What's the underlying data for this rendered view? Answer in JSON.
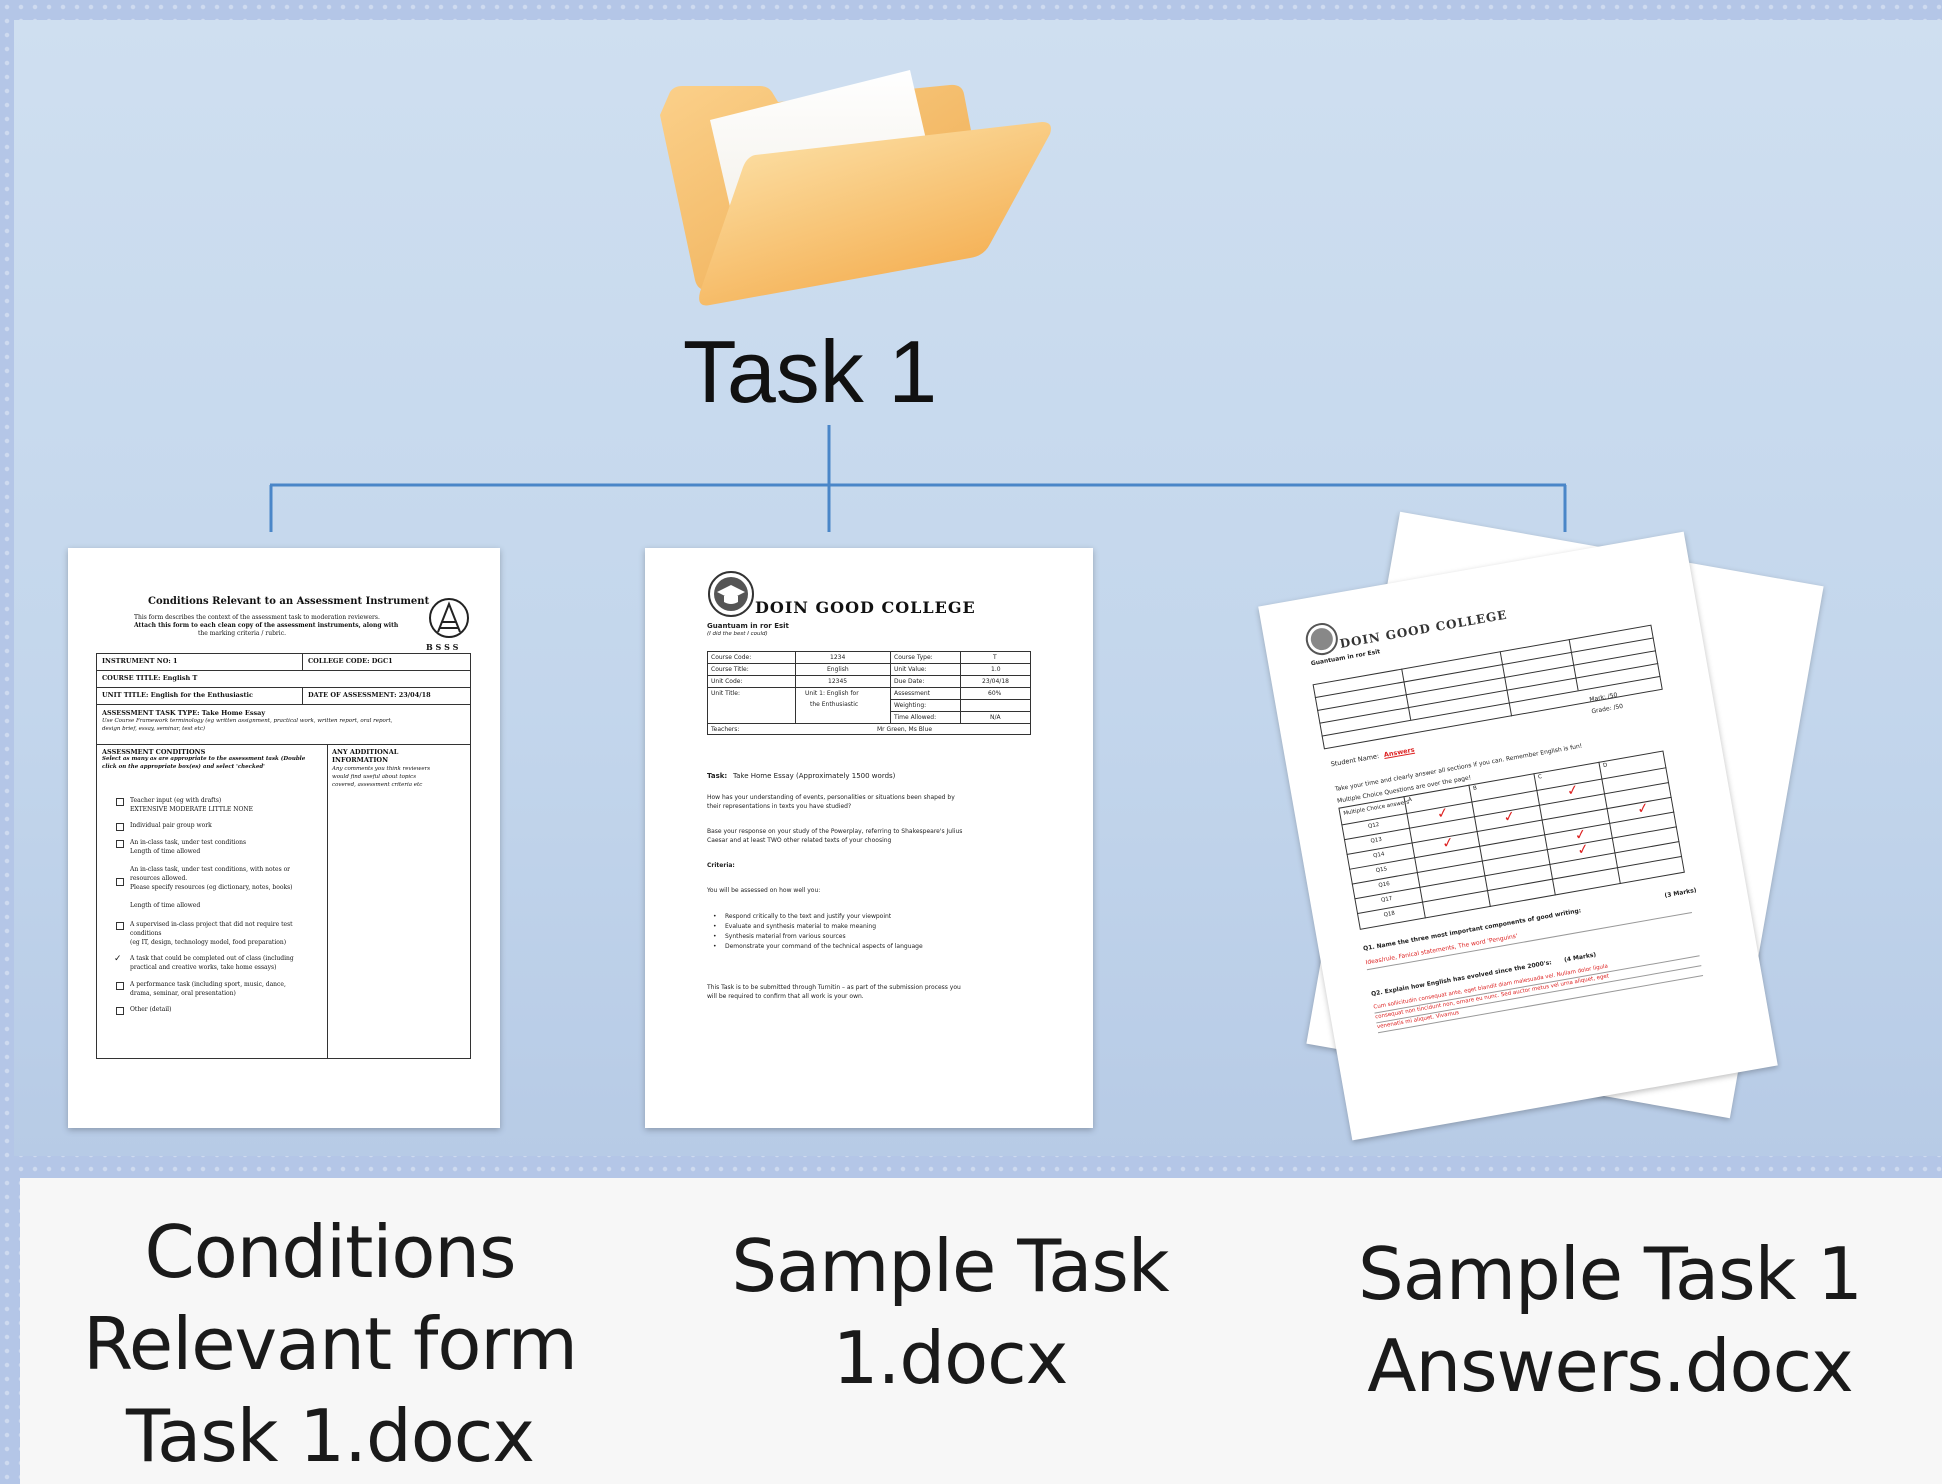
{
  "root": {
    "label": "Task 1"
  },
  "colors": {
    "connector": "#4a86c8",
    "folder_front": "#f6b95a",
    "folder_back": "#f3c06c"
  },
  "icons": {
    "root": "folder-icon"
  },
  "files": [
    {
      "name": "Conditions Relevant form Task 1.docx",
      "name_lines": [
        "Conditions",
        "Relevant form",
        "Task 1.docx"
      ],
      "preview": {
        "title": "Conditions Relevant to an Assessment Instrument",
        "intro": [
          "This form describes the context of the assessment task to moderation reviewers.",
          "Attach this form to each clean copy of the assessment instruments, along with",
          "the marking criteria / rubric."
        ],
        "logo_text": "B S S S",
        "instrument_no": "INSTRUMENT NO: 1",
        "college_code": "COLLEGE CODE: DGC1",
        "course_title": "COURSE TITLE: English T",
        "unit_title": "UNIT TITLE: English for the Enthusiastic",
        "date": "DATE OF ASSESSMENT: 23/04/18",
        "task_type": "ASSESSMENT TASK TYPE: Take Home Essay",
        "task_type_note": [
          "Use Course Framework terminology (eg written assignment, practical work, written report, oral report,",
          "design brief, essay, seminar, test etc)"
        ],
        "conditions_heading": "ASSESSMENT CONDITIONS",
        "conditions_note": [
          "Select as many as are appropriate to the assessment task (Double",
          "click on the appropriate box(es) and select 'checked'"
        ],
        "additional_heading": [
          "ANY ADDITIONAL",
          "INFORMATION"
        ],
        "additional_note": [
          "Any comments you think reviewers",
          "would find useful about topics",
          "covered, assessment criteria etc"
        ],
        "items": [
          "Teacher input (eg with drafts)",
          "EXTENSIVE   MODERATE   LITTLE   NONE",
          "Individual   pair   group work",
          "An in-class task, under test conditions",
          "Length of time allowed",
          "An in-class task, under test conditions, with notes or",
          "resources allowed.",
          "Please specify resources (eg dictionary, notes, books)",
          "Length of time allowed",
          "A supervised in-class project that did not require test",
          "conditions",
          "(eg IT, design, technology model, food preparation)",
          "A task that could be completed out of class (including",
          "practical and creative works, take home essays)",
          "A performance task (including sport, music, dance,",
          "drama, seminar, oral presentation)",
          "Other (detail)"
        ]
      }
    },
    {
      "name": "Sample Task 1.docx",
      "name_lines": [
        "Sample Task",
        "1.docx"
      ],
      "preview": {
        "college": "DOIN GOOD COLLEGE",
        "subtitle": "Guantuam in ror Esit",
        "subtitle2": "(I did the best I could)",
        "table": [
          [
            "Course Code:",
            "1234",
            "Course Type:",
            "T"
          ],
          [
            "Course Title:",
            "English",
            "Unit Value:",
            "1.0"
          ],
          [
            "Unit Code:",
            "12345",
            "Due Date:",
            "23/04/18"
          ],
          [
            "Unit Title:",
            "Unit 1: English for",
            "Assessment",
            "60%"
          ],
          [
            "",
            "the Enthusiastic",
            "Weighting:",
            ""
          ],
          [
            "",
            "",
            "Time Allowed:",
            "N/A"
          ],
          [
            "Teachers:",
            "",
            "Mr Green, Ms Blue",
            ""
          ]
        ],
        "task_label": "Task:",
        "task_text": "Take Home Essay (Approximately 1500 words)",
        "question": [
          "How has your understanding of events, personalities or situations been shaped by",
          "their representations in texts you have studied?"
        ],
        "base": [
          "Base your response on your study of the Powerplay, referring to Shakespeare's Julius",
          "Caesar and at least TWO other related texts of your choosing"
        ],
        "criteria_heading": "Criteria:",
        "criteria_intro": "You will be assessed on how well you:",
        "criteria": [
          "Respond critically to the text and justify your viewpoint",
          "Evaluate and synthesis material to make meaning",
          "Synthesis material from various sources",
          "Demonstrate your command of the technical aspects of language"
        ],
        "submit": [
          "This Task is to be submitted through Turnitin – as part of the submission process you",
          "will be required to confirm that all work is your own."
        ]
      }
    },
    {
      "name": "Sample Task 1 Answers.docx",
      "name_lines": [
        "Sample Task 1",
        "Answers.docx"
      ],
      "preview": {
        "college": "DOIN GOOD COLLEGE",
        "subtitle": "Guantuam in ror Esit",
        "student_name_label": "Student Name:",
        "student_name_value": "Answers",
        "mark": "Mark: /50",
        "grade": "Grade: /50",
        "instructions": "Take your time and clearly answer all sections if you can. Remember English is fun!",
        "mc_heading": "Multiple Choice Questions are over the page!",
        "mc_rows": [
          "Q12",
          "Q13",
          "Q14",
          "Q15",
          "Q16",
          "Q17",
          "Q18"
        ],
        "mc_cols": [
          "Multiple Choice answers",
          "A",
          "B",
          "C",
          "D"
        ],
        "q1": "Q1. Name the three most important components of good writing:",
        "q1_marks": "(3 Marks)",
        "q1_answer": "Ideas/rule, Fanical statements, The word 'Penguins'",
        "q2": "Q2. Explain how English has evolved since the 2000's:",
        "q2_marks": "(4 Marks)",
        "q2_answer": [
          "Cum sollicitudin consequat ante, eget blandit diam malesuada vel. Nullam dolor ligula",
          "consequat non tincidunt non, ornare eu nunc. Sed auctor metus vel urna aliquet, eget",
          "venenatis mi aliquet. Vivamus"
        ]
      }
    }
  ]
}
